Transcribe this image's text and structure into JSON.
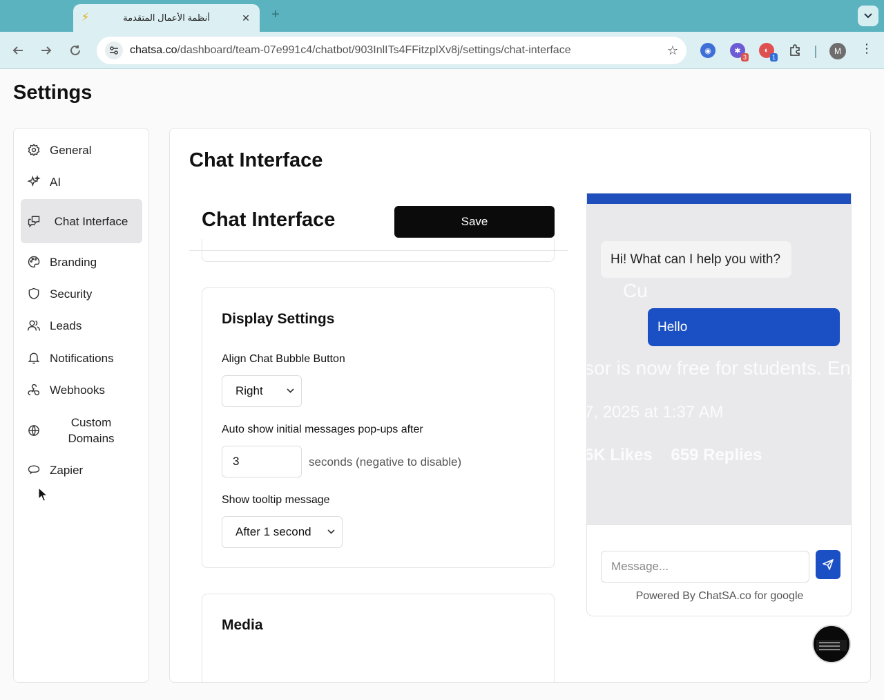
{
  "browser": {
    "tab_title": "أنظمة الأعمال المتقدمة",
    "tab_close": "✕",
    "new_tab": "+",
    "url_host": "chatsa.co",
    "url_path": "/dashboard/team-07e991c4/chatbot/903InlITs4FFitzplXv8j/settings/chat-interface",
    "profile_initial": "M",
    "ext_badge_1": "3",
    "ext_badge_2": "1"
  },
  "page": {
    "title": "Settings"
  },
  "sidebar": {
    "items": [
      {
        "label": "General",
        "icon": "gear-icon"
      },
      {
        "label": "AI",
        "icon": "sparkles-icon"
      },
      {
        "label": "Chat Interface",
        "icon": "chat-icon",
        "active": true
      },
      {
        "label": "Branding",
        "icon": "palette-icon"
      },
      {
        "label": "Security",
        "icon": "shield-icon"
      },
      {
        "label": "Leads",
        "icon": "users-icon"
      },
      {
        "label": "Notifications",
        "icon": "bell-icon"
      },
      {
        "label": "Webhooks",
        "icon": "webhook-icon"
      },
      {
        "label": "Custom Domains",
        "icon": "globe-icon"
      },
      {
        "label": "Zapier",
        "icon": "zapier-icon"
      }
    ]
  },
  "main": {
    "heading": "Chat Interface",
    "subheading": "Chat Interface",
    "save_label": "Save",
    "display_settings": {
      "title": "Display Settings",
      "align_label": "Align Chat Bubble Button",
      "align_value": "Right",
      "autoshow_label": "Auto show initial messages pop-ups after",
      "autoshow_value": "3",
      "autoshow_hint": "seconds (negative to disable)",
      "tooltip_label": "Show tooltip message",
      "tooltip_value": "After 1 second"
    },
    "media": {
      "title": "Media"
    }
  },
  "preview": {
    "bot_message": "Hi! What can I help you with?",
    "user_message": "Hello",
    "input_placeholder": "Message...",
    "powered_by": "Powered By ChatSA.co for google",
    "accent_color": "#1b4fc4"
  }
}
